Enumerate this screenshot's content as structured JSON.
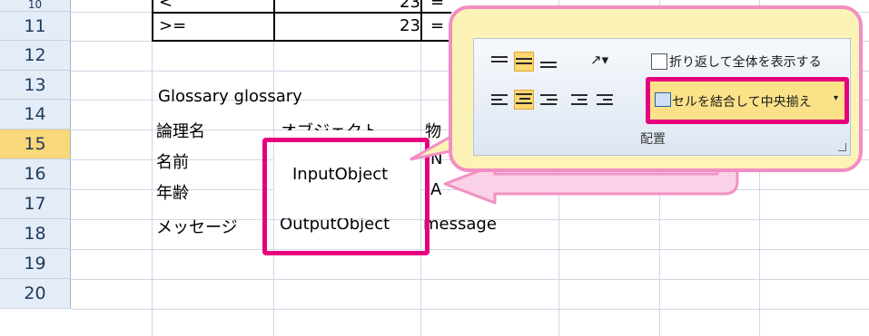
{
  "rows": [
    {
      "num": "10",
      "b": "<",
      "c": "23",
      "d": "="
    },
    {
      "num": "11",
      "b": ">=",
      "c": "23",
      "d": "="
    },
    {
      "num": "12",
      "b": "",
      "c": "",
      "d": ""
    },
    {
      "num": "13",
      "b": "Glossary glossary",
      "c": "",
      "d": ""
    },
    {
      "num": "14",
      "b": "論理名",
      "c": "オブジェクト",
      "d": "物"
    },
    {
      "num": "15",
      "b": "名前",
      "c": "",
      "d": "N"
    },
    {
      "num": "16",
      "b": "年齢",
      "c": "",
      "d": "A"
    },
    {
      "num": "17",
      "b": "メッセージ",
      "c": "OutputObject",
      "d": "message"
    },
    {
      "num": "18",
      "b": "",
      "c": "",
      "d": ""
    },
    {
      "num": "19",
      "b": "",
      "c": "",
      "d": ""
    },
    {
      "num": "20",
      "b": "",
      "c": "",
      "d": ""
    }
  ],
  "merged_cell": "InputObject",
  "ribbon": {
    "wrap_text": "折り返して全体を表示する",
    "merge_center": "セルを結合して中央揃え",
    "group_label": "配置"
  },
  "colors": {
    "highlight": "#e6007e",
    "callout_bg": "#fdf3b6",
    "selected_row": "#f8d878"
  }
}
